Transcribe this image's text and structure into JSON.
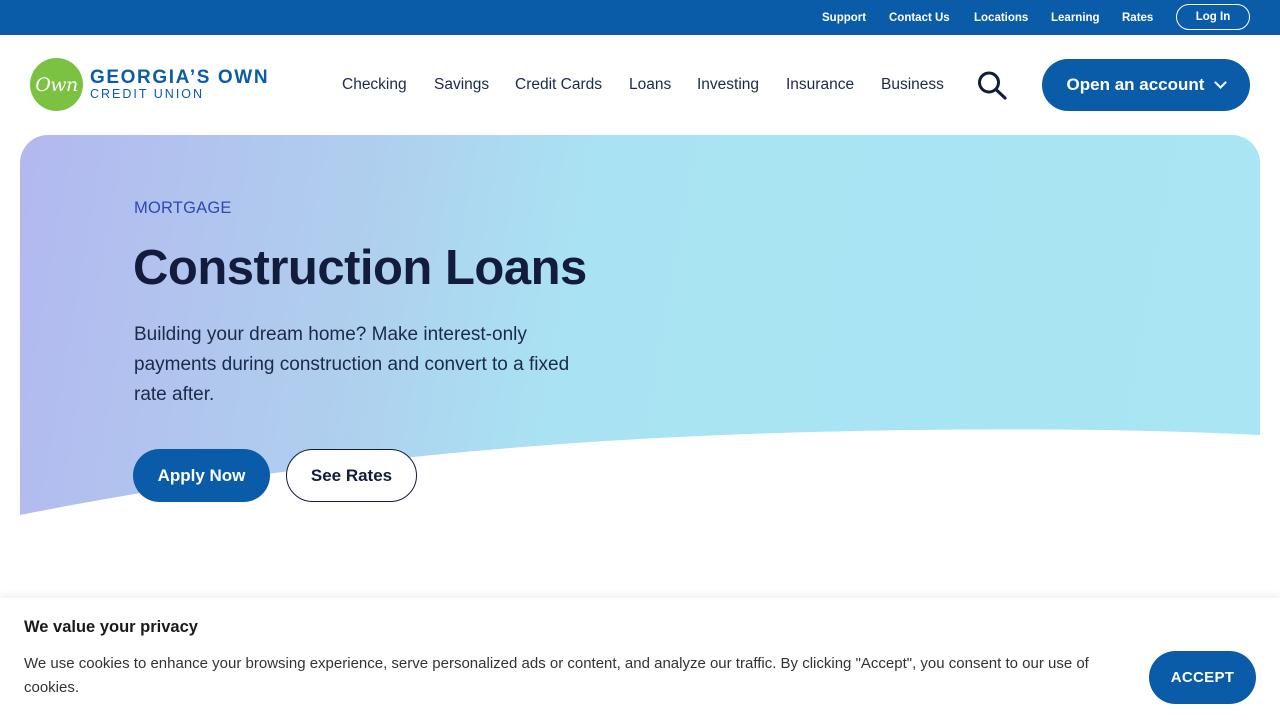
{
  "utility_nav": {
    "links": [
      "Support",
      "Contact Us",
      "Locations",
      "Learning",
      "Rates"
    ],
    "login_label": "Log In"
  },
  "logo": {
    "badge_text": "Own",
    "name_line1": "GEORGIA’S OWN",
    "name_line2": "CREDIT UNION"
  },
  "main_nav": {
    "items": [
      "Checking",
      "Savings",
      "Credit Cards",
      "Loans",
      "Investing",
      "Insurance",
      "Business"
    ],
    "search_icon": "search-icon",
    "open_account_label": "Open an account"
  },
  "hero": {
    "eyebrow": "MORTGAGE",
    "title": "Construction Loans",
    "description": "Building your dream home? Make interest-only payments during construction and convert to a fixed rate after.",
    "primary_cta": "Apply Now",
    "secondary_cta": "See Rates"
  },
  "cookie_banner": {
    "title": "We value your privacy",
    "text": "We use cookies to enhance your browsing experience, serve personalized ads or content, and analyze our traffic. By clicking \"Accept\", you consent to our use of cookies.",
    "accept_label": "ACCEPT"
  },
  "colors": {
    "brand_blue": "#0a5ca8",
    "brand_green": "#7cc242",
    "dark_navy": "#131c3c",
    "eyebrow_blue": "#2e49b5"
  }
}
